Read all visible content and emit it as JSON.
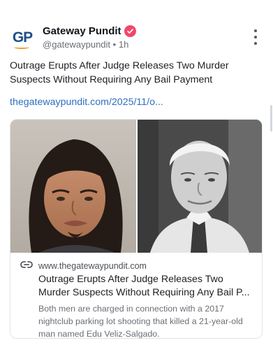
{
  "post": {
    "author": {
      "display_name": "Gateway Pundit",
      "handle": "@gatewaypundit",
      "separator": "•",
      "time_ago": "1h",
      "avatar_text": "GP"
    },
    "text": "Outrage Erupts After Judge Releases Two Murder Suspects Without Requiring Any Bail Payment",
    "link_text": "thegatewaypundit.com/2025/11/o...",
    "link_card": {
      "domain": "www.thegatewaypundit.com",
      "title_line1": "Outrage Erupts After Judge Releases Two",
      "title_line2": "Murder Suspects Without Requiring Any Bail P...",
      "description": "Both men are charged in connection with a 2017 nightclub parking lot shooting that killed a 21-year-old man named Edu Veliz-Salgado."
    }
  },
  "icons": {
    "verified": "verified-check-icon",
    "more": "more-options-icon",
    "link": "link-icon"
  },
  "colors": {
    "link": "#2c6fbf",
    "verified_badge": "#f3466b",
    "avatar_brand": "#1f4e8c",
    "avatar_accent": "#e9a21d"
  }
}
